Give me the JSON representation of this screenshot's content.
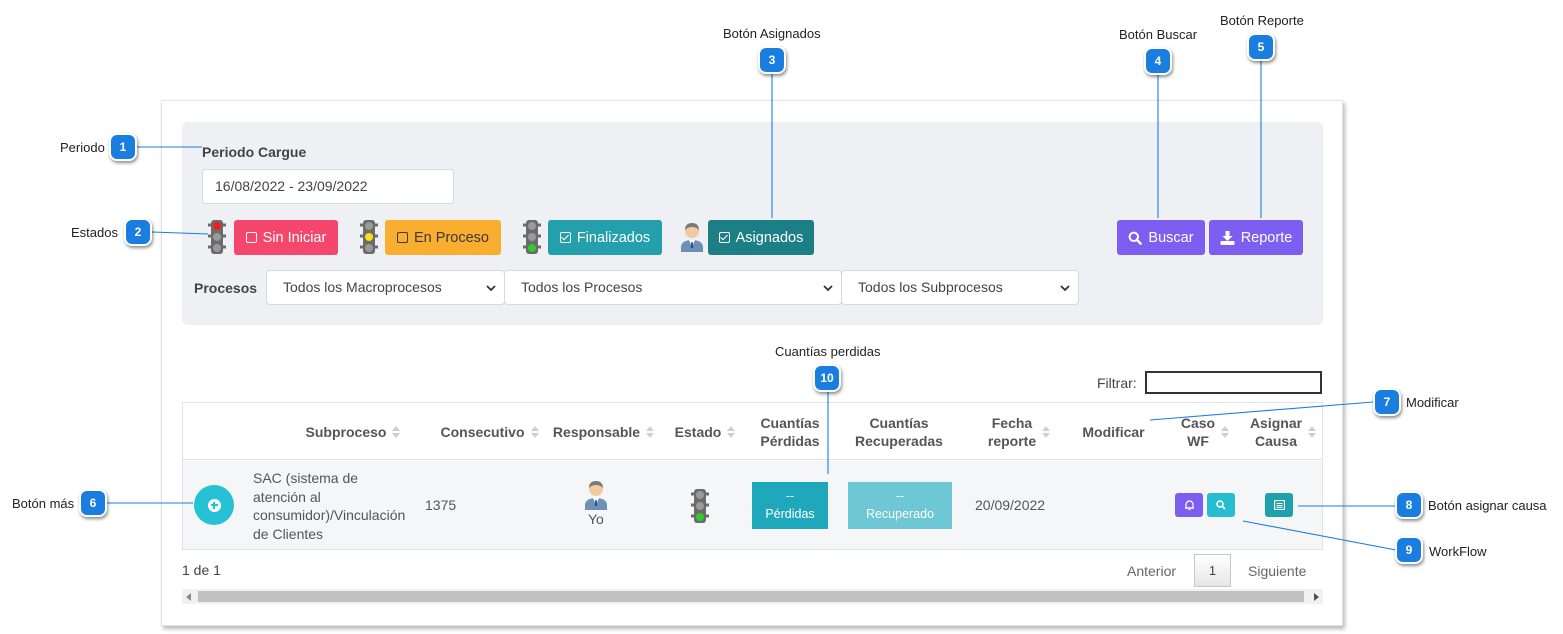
{
  "colors": {
    "callout_blue": "#1a7de0",
    "sin_iniciar": "#f5476d",
    "en_proceso": "#f9ae2f",
    "finalizados": "#24a0ad",
    "asignados": "#1c7f86",
    "buscar": "#7c5ef0",
    "reporte": "#7c5ef0",
    "cuantias_perdidas": "#1fa7bc",
    "cuantias_recuperadas": "#6ec7d4",
    "caso_wf_bell": "#7c5ef0",
    "caso_wf_search": "#27bccf",
    "asignar_causa": "#1fa0ad"
  },
  "callouts": {
    "c1": {
      "number": "1",
      "label": "Periodo"
    },
    "c2": {
      "number": "2",
      "label": "Estados"
    },
    "c3": {
      "number": "3",
      "label": "Botón Asignados"
    },
    "c4": {
      "number": "4",
      "label": "Botón Buscar"
    },
    "c5": {
      "number": "5",
      "label": "Botón Reporte"
    },
    "c6": {
      "number": "6",
      "label": "Botón más"
    },
    "c7": {
      "number": "7",
      "label": "Modificar"
    },
    "c8": {
      "number": "8",
      "label": "Botón asignar causa"
    },
    "c9": {
      "number": "9",
      "label": "WorkFlow"
    },
    "c10": {
      "number": "10",
      "label": "Cuantías perdidas"
    }
  },
  "filters": {
    "period_label": "Periodo Cargue",
    "period_value": "16/08/2022 - 23/09/2022",
    "status_buttons": {
      "sin_iniciar": "Sin Iniciar",
      "en_proceso": "En Proceso",
      "finalizados": "Finalizados",
      "asignados": "Asignados"
    },
    "buscar_label": "Buscar",
    "reporte_label": "Reporte",
    "procesos_label": "Procesos",
    "macroprocesos_selected": "Todos los Macroprocesos",
    "procesos_selected": "Todos los Procesos",
    "subprocesos_selected": "Todos los Subprocesos"
  },
  "table": {
    "filter_label": "Filtrar:",
    "filter_value": "",
    "headers": {
      "subproceso": "Subproceso",
      "consecutivo": "Consecutivo",
      "responsable": "Responsable",
      "estado": "Estado",
      "cuantias_perdidas_1": "Cuantías",
      "cuantias_perdidas_2": "Pérdidas",
      "cuantias_recuperadas_1": "Cuantías",
      "cuantias_recuperadas_2": "Recuperadas",
      "fecha_1": "Fecha",
      "fecha_2": "reporte",
      "modificar": "Modificar",
      "caso_wf_1": "Caso",
      "caso_wf_2": "WF",
      "asignar_causa_1": "Asignar",
      "asignar_causa_2": "Causa"
    },
    "row": {
      "subproceso_lines": [
        "SAC (sistema de",
        "atención al",
        "consumidor)/Vinculación",
        "de Clientes"
      ],
      "consecutivo": "1375",
      "responsable": "Yo",
      "perdidas_value": "--",
      "perdidas_label": "Pérdidas",
      "recuperadas_value": "--",
      "recuperadas_label": "Recuperado",
      "fecha_reporte": "20/09/2022"
    },
    "info": "1 de 1",
    "pager": {
      "prev": "Anterior",
      "page": "1",
      "next": "Siguiente"
    }
  }
}
